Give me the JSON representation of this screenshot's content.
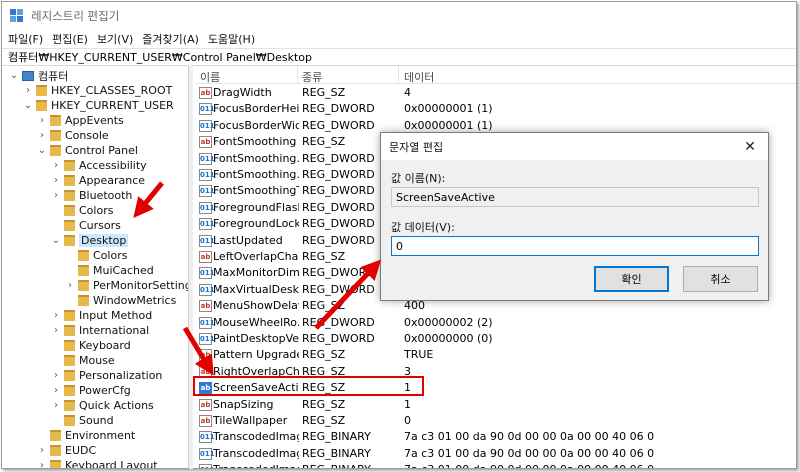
{
  "window": {
    "title": "레지스트리 편집기"
  },
  "menu": [
    "파일(F)",
    "편집(E)",
    "보기(V)",
    "즐겨찾기(A)",
    "도움말(H)"
  ],
  "address": "컴퓨터₩HKEY_CURRENT_USER₩Control Panel₩Desktop",
  "tree": [
    {
      "label": "컴퓨터",
      "level": 0,
      "chev": "v",
      "icon": "computer-icon"
    },
    {
      "label": "HKEY_CLASSES_ROOT",
      "level": 1,
      "chev": ">"
    },
    {
      "label": "HKEY_CURRENT_USER",
      "level": 1,
      "chev": "v"
    },
    {
      "label": "AppEvents",
      "level": 2,
      "chev": ">"
    },
    {
      "label": "Console",
      "level": 2,
      "chev": ">"
    },
    {
      "label": "Control Panel",
      "level": 2,
      "chev": "v"
    },
    {
      "label": "Accessibility",
      "level": 3,
      "chev": ">"
    },
    {
      "label": "Appearance",
      "level": 3,
      "chev": ">"
    },
    {
      "label": "Bluetooth",
      "level": 3,
      "chev": ">"
    },
    {
      "label": "Colors",
      "level": 3,
      "chev": ""
    },
    {
      "label": "Cursors",
      "level": 3,
      "chev": ""
    },
    {
      "label": "Desktop",
      "level": 3,
      "chev": "v",
      "selected": true
    },
    {
      "label": "Colors",
      "level": 4,
      "chev": ""
    },
    {
      "label": "MuiCached",
      "level": 4,
      "chev": ""
    },
    {
      "label": "PerMonitorSettings",
      "level": 4,
      "chev": ">"
    },
    {
      "label": "WindowMetrics",
      "level": 4,
      "chev": ""
    },
    {
      "label": "Input Method",
      "level": 3,
      "chev": ">"
    },
    {
      "label": "International",
      "level": 3,
      "chev": ">"
    },
    {
      "label": "Keyboard",
      "level": 3,
      "chev": ""
    },
    {
      "label": "Mouse",
      "level": 3,
      "chev": ""
    },
    {
      "label": "Personalization",
      "level": 3,
      "chev": ">"
    },
    {
      "label": "PowerCfg",
      "level": 3,
      "chev": ">"
    },
    {
      "label": "Quick Actions",
      "level": 3,
      "chev": ">"
    },
    {
      "label": "Sound",
      "level": 3,
      "chev": ""
    },
    {
      "label": "Environment",
      "level": 2,
      "chev": ""
    },
    {
      "label": "EUDC",
      "level": 2,
      "chev": ">"
    },
    {
      "label": "Keyboard Layout",
      "level": 2,
      "chev": ">"
    }
  ],
  "columns": {
    "name": "이름",
    "type": "종류",
    "data": "데이터"
  },
  "values": [
    {
      "name": "DragWidth",
      "type": "REG_SZ",
      "data": "4",
      "icon": "string-value-icon"
    },
    {
      "name": "FocusBorderHei...",
      "type": "REG_DWORD",
      "data": "0x00000001 (1)",
      "icon": "binary-value-icon"
    },
    {
      "name": "FocusBorderWid...",
      "type": "REG_DWORD",
      "data": "0x00000001 (1)",
      "icon": "binary-value-icon"
    },
    {
      "name": "FontSmoothing",
      "type": "REG_SZ",
      "data": "",
      "icon": "string-value-icon"
    },
    {
      "name": "FontSmoothing...",
      "type": "REG_DWORD",
      "data": "",
      "icon": "binary-value-icon"
    },
    {
      "name": "FontSmoothing...",
      "type": "REG_DWORD",
      "data": "",
      "icon": "binary-value-icon"
    },
    {
      "name": "FontSmoothingT...",
      "type": "REG_DWORD",
      "data": "",
      "icon": "binary-value-icon"
    },
    {
      "name": "ForegroundFlash...",
      "type": "REG_DWORD",
      "data": "",
      "icon": "binary-value-icon"
    },
    {
      "name": "ForegroundLock...",
      "type": "REG_DWORD",
      "data": "",
      "icon": "binary-value-icon"
    },
    {
      "name": "LastUpdated",
      "type": "REG_DWORD",
      "data": "",
      "icon": "binary-value-icon"
    },
    {
      "name": "LeftOverlapChars",
      "type": "REG_SZ",
      "data": "",
      "icon": "string-value-icon"
    },
    {
      "name": "MaxMonitorDim...",
      "type": "REG_DWORD",
      "data": "",
      "icon": "binary-value-icon"
    },
    {
      "name": "MaxVirtualDeskt...",
      "type": "REG_DWORD",
      "data": "",
      "icon": "binary-value-icon"
    },
    {
      "name": "MenuShowDelay",
      "type": "REG_SZ",
      "data": "400",
      "icon": "string-value-icon"
    },
    {
      "name": "MouseWheelRo...",
      "type": "REG_DWORD",
      "data": "0x00000002 (2)",
      "icon": "binary-value-icon"
    },
    {
      "name": "PaintDesktopVe...",
      "type": "REG_DWORD",
      "data": "0x00000000 (0)",
      "icon": "binary-value-icon"
    },
    {
      "name": "Pattern Upgrade",
      "type": "REG_SZ",
      "data": "TRUE",
      "icon": "string-value-icon"
    },
    {
      "name": "RightOverlapCh...",
      "type": "REG_SZ",
      "data": "3",
      "icon": "string-value-icon"
    },
    {
      "name": "ScreenSaveActive",
      "type": "REG_SZ",
      "data": "1",
      "icon": "string-value-icon",
      "highlight": true
    },
    {
      "name": "SnapSizing",
      "type": "REG_SZ",
      "data": "1",
      "icon": "string-value-icon"
    },
    {
      "name": "TileWallpaper",
      "type": "REG_SZ",
      "data": "0",
      "icon": "string-value-icon"
    },
    {
      "name": "TranscodedImag...",
      "type": "REG_BINARY",
      "data": "7a c3 01 00 da 90 0d 00 00 0a 00 00 40 06 00 00 ...",
      "icon": "binary-value-icon"
    },
    {
      "name": "TranscodedImag...",
      "type": "REG_BINARY",
      "data": "7a c3 01 00 da 90 0d 00 00 0a 00 00 40 06 00 00 ...",
      "icon": "binary-value-icon"
    },
    {
      "name": "TranscodedImag...",
      "type": "REG_BINARY",
      "data": "7a c3 01 00 da 90 0d 00 00 0a 00 00 40 06 00 00 ...",
      "icon": "binary-value-icon"
    }
  ],
  "dialog": {
    "title": "문자열 편집",
    "close": "✕",
    "name_label": "값 이름(N):",
    "name_value": "ScreenSaveActive",
    "data_label": "값 데이터(V):",
    "data_value": "0",
    "ok": "확인",
    "cancel": "취소"
  },
  "colors": {
    "annotation": "#e00000",
    "accent": "#0078d7",
    "selection": "#cce8ff"
  }
}
